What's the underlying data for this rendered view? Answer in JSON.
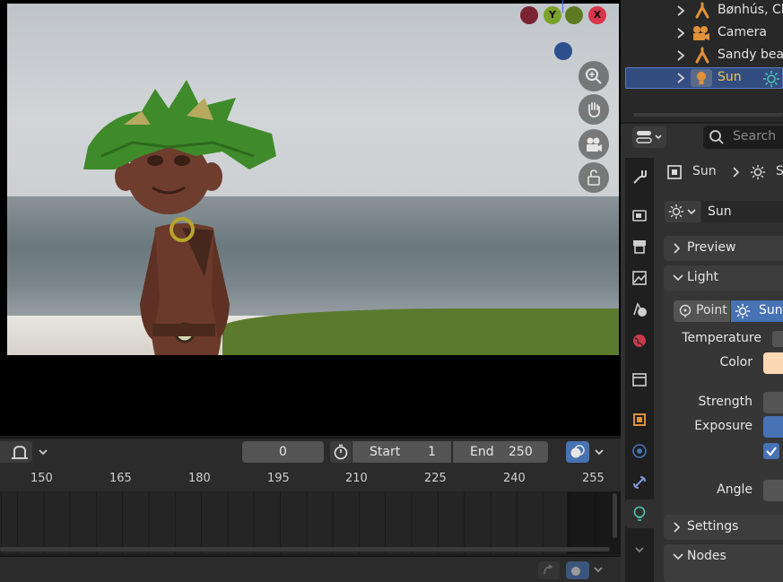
{
  "viewport": {
    "gizmo": {
      "y": "Y",
      "x": "X",
      "colors": {
        "x": "#d9344c",
        "y": "#7aa12a",
        "z": "#3b6fd6",
        "neg_x": "#7a2432",
        "neg_y": "#5f7b22",
        "neg_z": "#2d4f8f"
      }
    },
    "nav_icons": [
      "zoom-icon",
      "hand-pan-icon",
      "camera-icon",
      "lock-icon"
    ]
  },
  "timeline": {
    "current_frame": "0",
    "start_label": "Start",
    "start_value": "1",
    "end_label": "End",
    "end_value": "250",
    "ruler": [
      "150",
      "165",
      "180",
      "195",
      "210",
      "225",
      "240",
      "255"
    ]
  },
  "outliner": {
    "items": [
      {
        "label": "Bønhús, Ch",
        "icon": "armature-icon"
      },
      {
        "label": "Camera",
        "icon": "camera-object-icon"
      },
      {
        "label": "Sandy beac",
        "icon": "armature-icon"
      },
      {
        "label": "Sun",
        "icon": "light-icon",
        "selected": true
      }
    ]
  },
  "properties": {
    "search_placeholder": "Search",
    "breadcrumb_object": "Sun",
    "breadcrumb_data": "S",
    "datablock_name": "Sun",
    "panels": {
      "preview": "Preview",
      "light": "Light",
      "settings": "Settings",
      "nodes": "Nodes"
    },
    "light_types": {
      "point": "Point",
      "sun": "Sun"
    },
    "labels": {
      "temperature": "Temperature",
      "color": "Color",
      "strength": "Strength",
      "exposure": "Exposure",
      "angle": "Angle"
    },
    "color_swatch": "#fcd9b4",
    "accent": "#4772b3"
  }
}
